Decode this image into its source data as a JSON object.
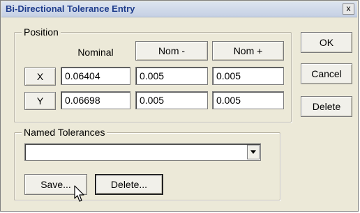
{
  "window": {
    "title": "Bi-Directional Tolerance Entry",
    "close_glyph": "x"
  },
  "position": {
    "group_label": "Position",
    "header_nominal": "Nominal",
    "header_nom_minus": "Nom -",
    "header_nom_plus": "Nom +",
    "rows": [
      {
        "axis": "X",
        "nominal": "0.06404",
        "nom_minus": "0.005",
        "nom_plus": "0.005"
      },
      {
        "axis": "Y",
        "nominal": "0.06698",
        "nom_minus": "0.005",
        "nom_plus": "0.005"
      }
    ]
  },
  "buttons": {
    "ok": "OK",
    "cancel": "Cancel",
    "delete": "Delete"
  },
  "named_tolerances": {
    "group_label": "Named Tolerances",
    "selected_value": "",
    "save_label": "Save...",
    "delete_label": "Delete..."
  },
  "colors": {
    "dialog_background": "#ece9d8",
    "title_text": "#1f3d8c"
  },
  "icons": {
    "close": "close-icon",
    "dropdown": "chevron-down-icon",
    "cursor": "mouse-pointer-icon"
  }
}
